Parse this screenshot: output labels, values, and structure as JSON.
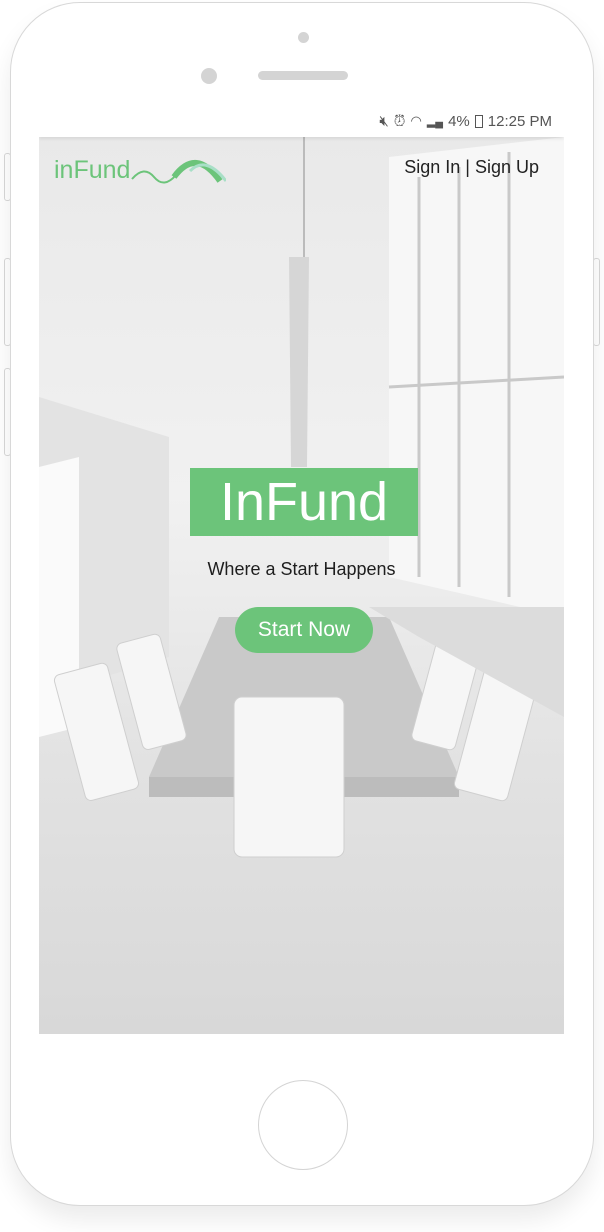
{
  "status_bar": {
    "icons": [
      "mute-icon",
      "alarm-icon",
      "wifi-icon",
      "signal-icon"
    ],
    "battery": "4%",
    "time": "12:25 PM"
  },
  "header": {
    "logo_text": "inFund",
    "sign_in": "Sign In",
    "separator": "|",
    "sign_up": "Sign Up"
  },
  "hero": {
    "title": "InFund",
    "tagline": "Where a Start Happens",
    "cta": "Start Now"
  },
  "colors": {
    "accent": "#6cc47a"
  }
}
